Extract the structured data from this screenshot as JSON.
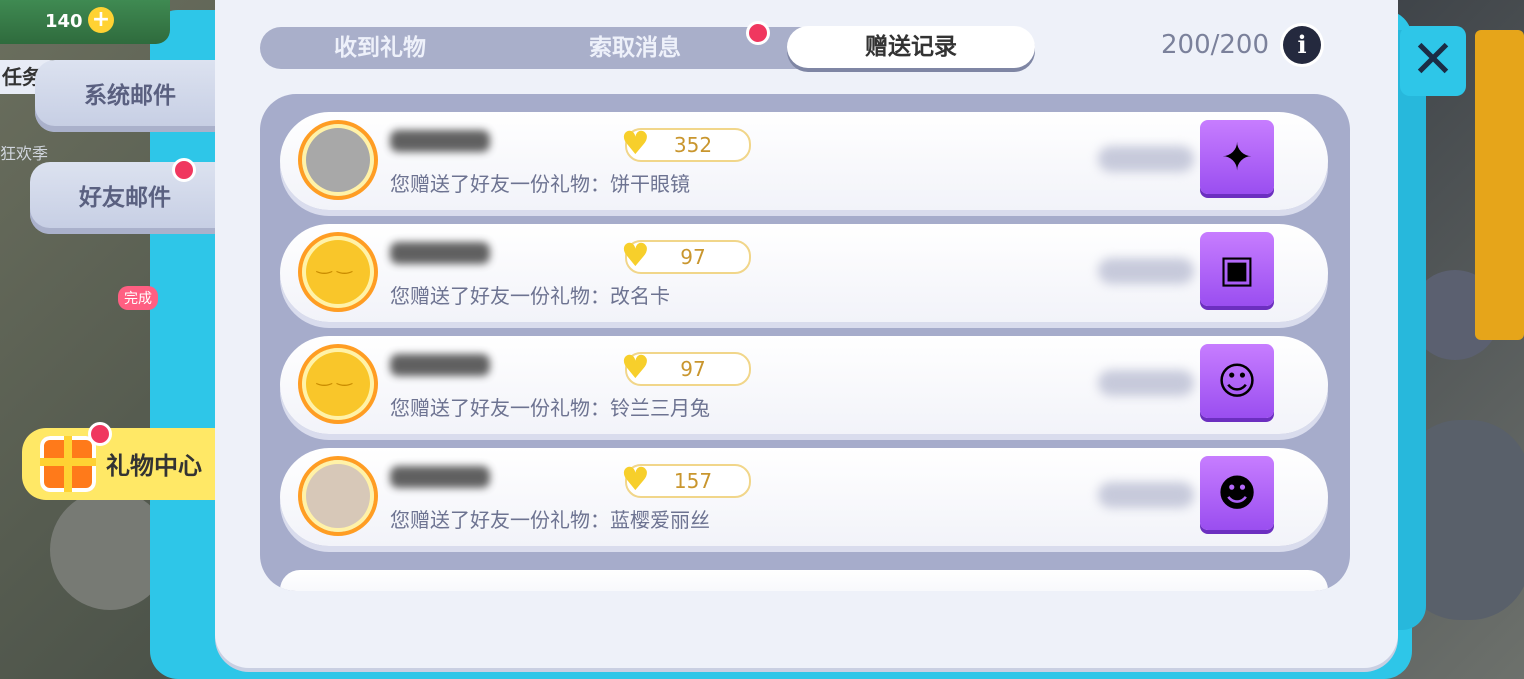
{
  "currency": {
    "value": "140",
    "plus_icon": "plus-icon"
  },
  "left_nav": {
    "task_tab": "任务",
    "system_mail": "系统邮件",
    "friend_mail": "好友邮件",
    "gift_center": "礼物中心",
    "season_text": "狂欢季",
    "done_badge": "完成"
  },
  "tabs": [
    {
      "label": "收到礼物",
      "active": false
    },
    {
      "label": "索取消息",
      "active": false,
      "has_dot": true
    },
    {
      "label": "赠送记录",
      "active": true
    }
  ],
  "count": "200/200",
  "info_icon": "info-icon",
  "close_icon": "close-icon",
  "records": [
    {
      "desc": "您赠送了好友一份礼物：",
      "gift": "饼干眼镜",
      "hearts": "352",
      "avatar": "photo",
      "item_icon": "glasses-icon"
    },
    {
      "desc": "您赠送了好友一份礼物：",
      "gift": "改名卡",
      "hearts": "97",
      "avatar": "face",
      "item_icon": "rename-card-icon"
    },
    {
      "desc": "您赠送了好友一份礼物：",
      "gift": "铃兰三月兔",
      "hearts": "97",
      "avatar": "face",
      "item_icon": "bunny-costume-icon"
    },
    {
      "desc": "您赠送了好友一份礼物：",
      "gift": "蓝樱爱丽丝",
      "hearts": "157",
      "avatar": "photo2",
      "item_icon": "alice-costume-icon"
    }
  ],
  "colors": {
    "accent": "#2ec6e8",
    "panel": "#eef1f9",
    "tab_bar": "#a9afca",
    "red_dot": "#f0375f",
    "heart": "#f7cf2b"
  }
}
